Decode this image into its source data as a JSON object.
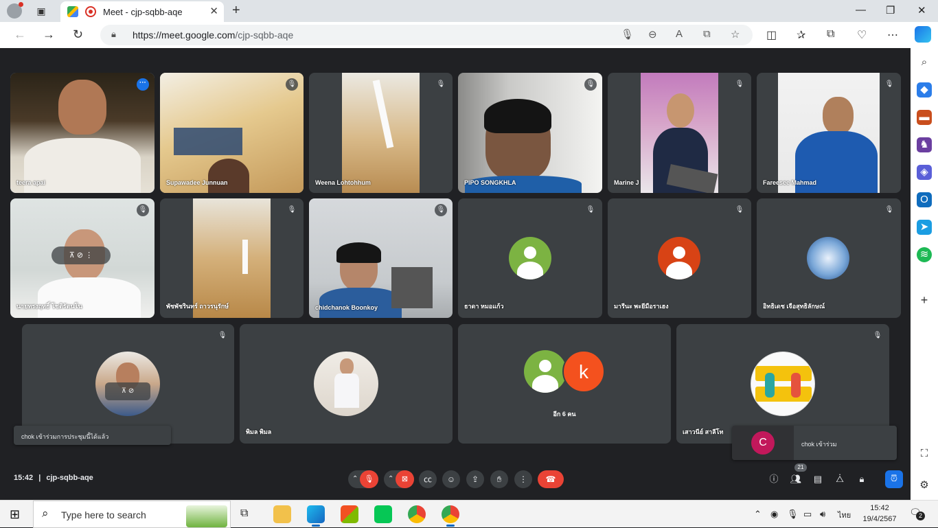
{
  "browser": {
    "tab_title": "Meet - cjp-sqbb-aqe",
    "url_host": "https://meet.google.com",
    "url_path": "/cjp-sqbb-aqe"
  },
  "tiles_row1": [
    {
      "name": "teera apai",
      "active": true
    },
    {
      "name": "Supawadee Junnuan"
    },
    {
      "name": "Weena Lohtohhum"
    },
    {
      "name": "PIPO SONGKHLA"
    },
    {
      "name": "Marine J"
    },
    {
      "name": "Fareesee Mahmad"
    }
  ],
  "tiles_row2": [
    {
      "name": "นายทรงฤทธิ์ โชติรัตนโน"
    },
    {
      "name": "พัชพัชรินทร์ ถาวรนุรักษ์"
    },
    {
      "name": "chidchanok Boonkoy"
    },
    {
      "name": "ธาดา หมอแก้ว",
      "avatar_color": "#7cb342"
    },
    {
      "name": "มารีนะ พะยีมือราเฮง",
      "avatar_color": "#d84315"
    },
    {
      "name": "อิทธิเดช เจือสุทธิลักษณ์"
    }
  ],
  "tiles_row3": [
    {
      "name": ""
    },
    {
      "name": "พิมล พิมล"
    },
    {
      "name": "อีก 6 คน",
      "extra_letter": "k"
    },
    {
      "name": "เสาวนีย์ สาลีโท"
    }
  ],
  "toasts": {
    "left": "chok เข้าร่วมการประชุมนี้ได้แล้ว",
    "right_letter": "C",
    "right": "chok เข้าร่วม"
  },
  "bottom": {
    "time": "15:42",
    "separator": "|",
    "meeting_code": "cjp-sqbb-aqe",
    "participant_count": "21"
  },
  "taskbar": {
    "search_placeholder": "Type here to search",
    "lang": "ไทย",
    "clock_time": "15:42",
    "clock_date": "19/4/2567",
    "notif_count": "2"
  },
  "colors": {
    "meet_bg": "#202124",
    "tile_bg": "#3c4043",
    "accent_blue": "#1a73e8",
    "hangup_red": "#ea4335"
  }
}
